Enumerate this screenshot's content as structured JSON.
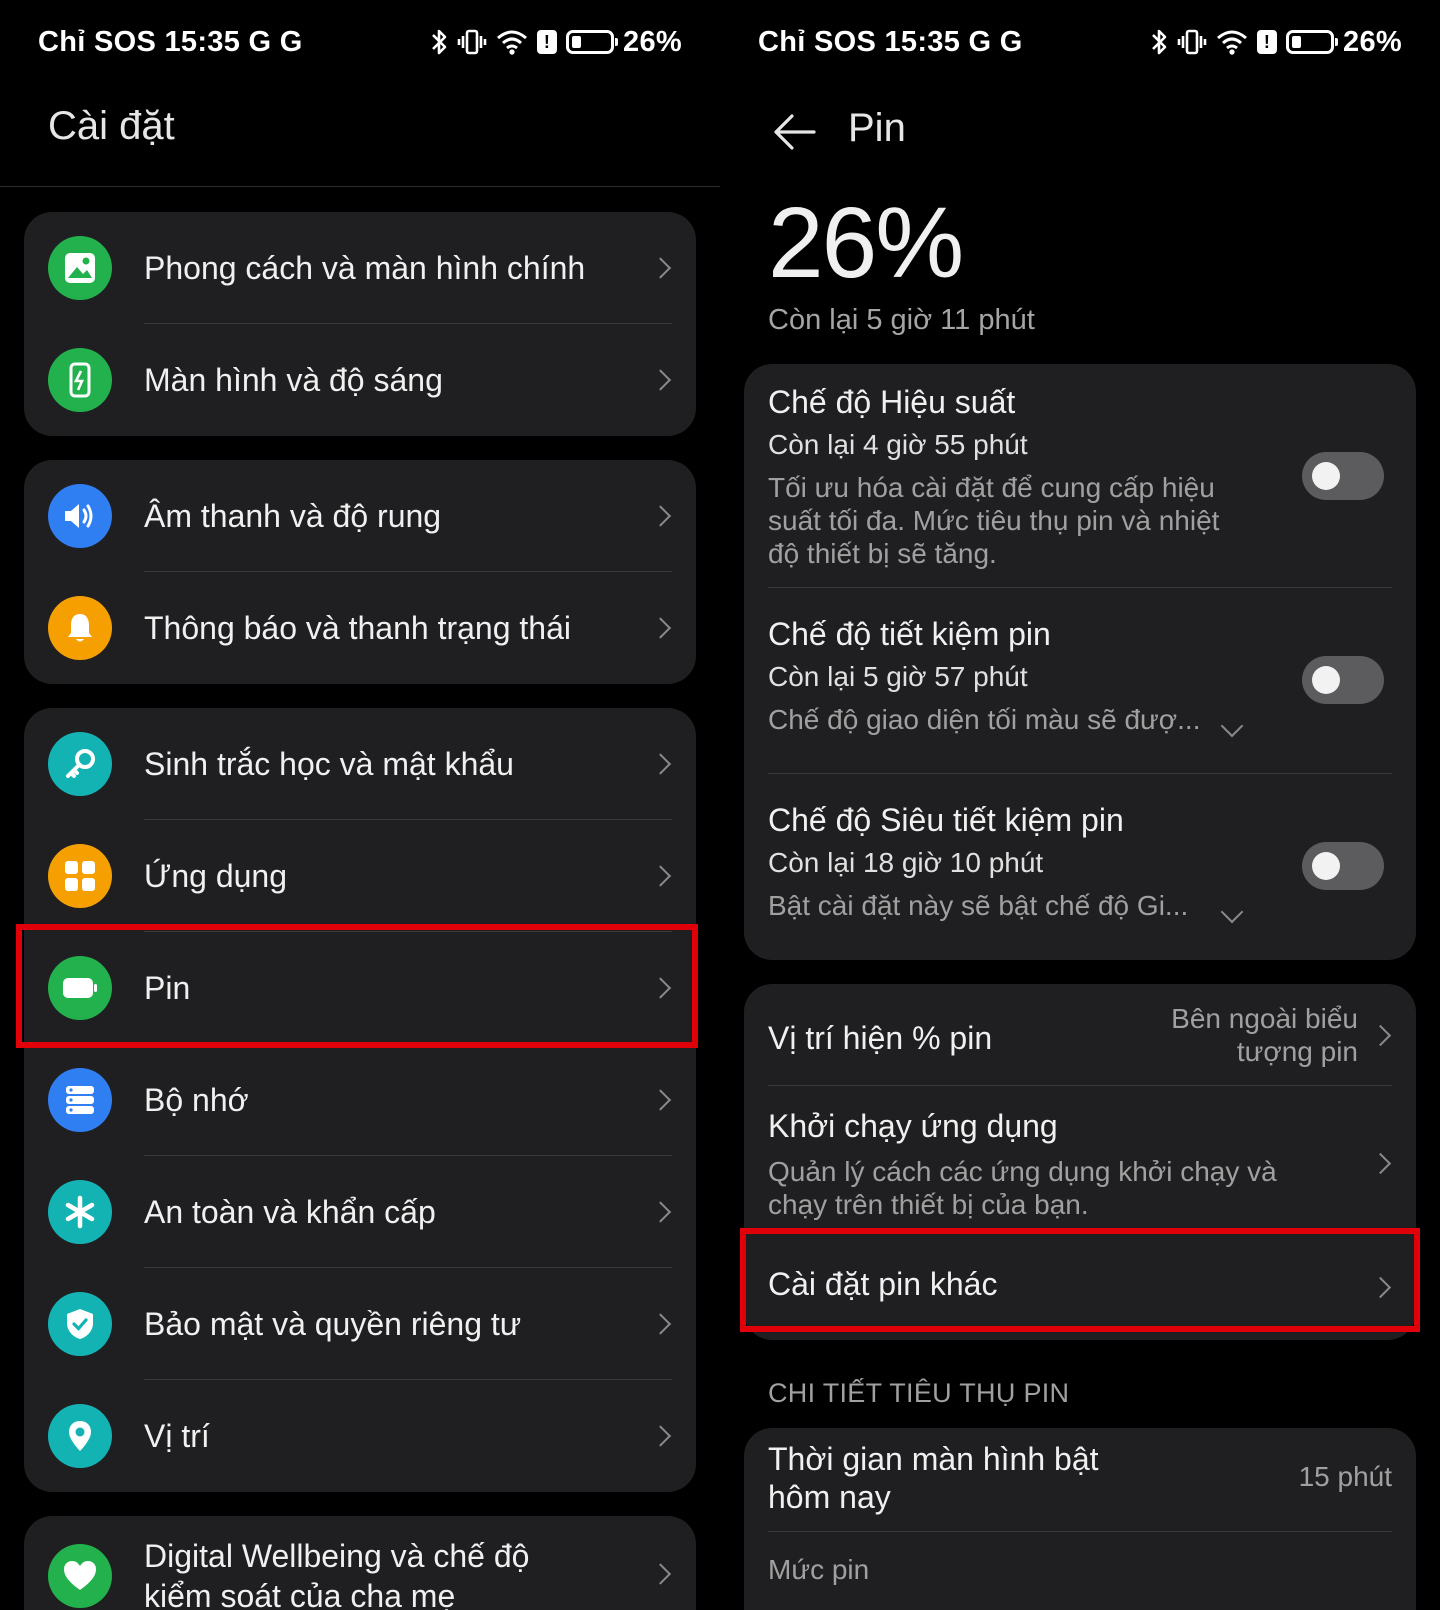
{
  "status_bar": {
    "left": "Chỉ SOS 15:35 G G",
    "battery_text": "26%",
    "battery_level": 0.26,
    "alert_glyph": "!"
  },
  "settings": {
    "title": "Cài đặt",
    "groups": [
      {
        "items": [
          {
            "label": "Phong cách và màn hình chính",
            "icon": "wallpaper-icon",
            "color": "#22b14c"
          },
          {
            "label": "Màn hình và độ sáng",
            "icon": "display-icon",
            "color": "#22b14c"
          }
        ]
      },
      {
        "items": [
          {
            "label": "Âm thanh và độ rung",
            "icon": "sound-icon",
            "color": "#2f7ff2"
          },
          {
            "label": "Thông báo và thanh trạng thái",
            "icon": "bell-icon",
            "color": "#f5a000"
          }
        ]
      },
      {
        "items": [
          {
            "label": "Sinh trắc học và mật khẩu",
            "icon": "key-icon",
            "color": "#14b3b3"
          },
          {
            "label": "Ứng dụng",
            "icon": "apps-icon",
            "color": "#f5a000"
          },
          {
            "label": "Pin",
            "icon": "battery-icon",
            "color": "#22b14c"
          },
          {
            "label": "Bộ nhớ",
            "icon": "storage-icon",
            "color": "#2f7ff2"
          },
          {
            "label": "An toàn và khẩn cấp",
            "icon": "asterisk-icon",
            "color": "#14b3b3"
          },
          {
            "label": "Bảo mật và quyền riêng tư",
            "icon": "shield-icon",
            "color": "#14b3b3"
          },
          {
            "label": "Vị trí",
            "icon": "location-icon",
            "color": "#14b3b3"
          }
        ]
      },
      {
        "items": [
          {
            "label_line1": "Digital Wellbeing và chế độ",
            "label_line2": "kiểm soát của cha mẹ",
            "icon": "heart-icon",
            "color": "#22b14c"
          }
        ]
      }
    ]
  },
  "battery": {
    "back_icon": "back-arrow-icon",
    "title": "Pin",
    "percent": "26%",
    "remaining": "Còn lại 5 giờ 11 phút",
    "modes": [
      {
        "title": "Chế độ Hiệu suất",
        "remaining": "Còn lại 4 giờ 55 phút",
        "desc": "Tối ưu hóa cài đặt để cung cấp hiệu suất tối đa. Mức tiêu thụ pin và nhiệt độ thiết bị sẽ tăng.",
        "enabled": false
      },
      {
        "title": "Chế độ tiết kiệm pin",
        "remaining": "Còn lại 5 giờ 57 phút",
        "desc": "Chế độ giao diện tối màu sẽ đượ...",
        "enabled": false
      },
      {
        "title": "Chế độ Siêu tiết kiệm pin",
        "remaining": "Còn lại 18 giờ 10 phút",
        "desc": "Bật cài đặt này sẽ bật chế độ Gi...",
        "enabled": false
      }
    ],
    "settings_rows": {
      "percent_position": {
        "title": "Vị trí hiện % pin",
        "value_line1": "Bên ngoài biểu",
        "value_line2": "tượng pin"
      },
      "app_launch": {
        "title": "Khởi chạy ứng dụng",
        "desc": "Quản lý cách các ứng dụng khởi chạy và chạy trên thiết bị của bạn."
      },
      "other": {
        "title": "Cài đặt pin khác"
      }
    },
    "usage_section": {
      "header": "CHI TIẾT TIÊU THỤ PIN",
      "screen_on_title_line1": "Thời gian màn hình bật",
      "screen_on_title_line2": "hôm nay",
      "screen_on_value": "15 phút",
      "battery_level_label": "Mức pin"
    }
  },
  "colors": {
    "highlight": "#e0000a",
    "card": "#1f1f21"
  }
}
